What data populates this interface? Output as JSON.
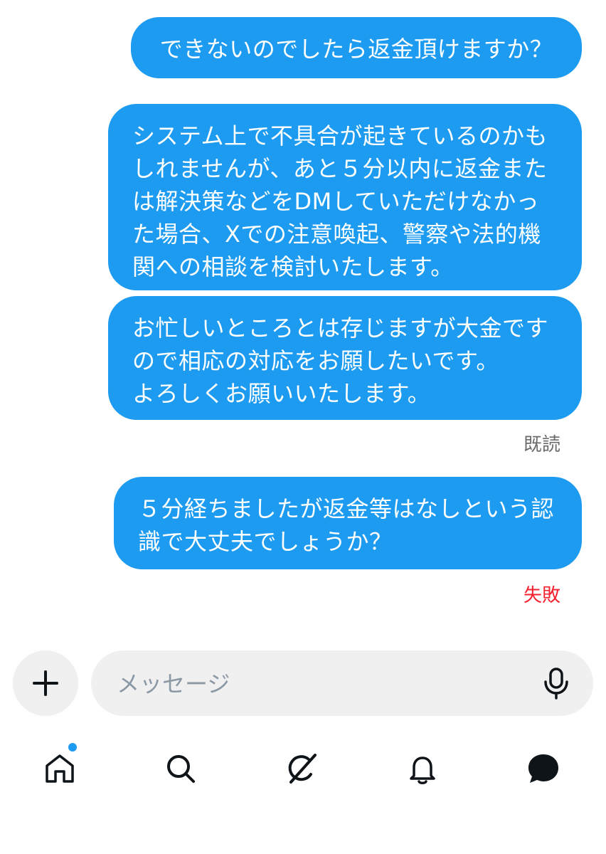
{
  "messages": [
    {
      "lines": [
        "できないのでしたら返金頂けますか？"
      ]
    },
    {
      "lines": [
        "システム上で不具合が起きているのかも",
        "しれませんが、あと５分以内に返金また",
        "は解決策などをDMしていただけなかっ",
        "た場合、Xでの注意喚起、警察や法的機",
        "関への相談を検討いたします。"
      ]
    },
    {
      "lines": [
        "お忙しいところとは存じますが大金です",
        "ので相応の対応をお願したいです。",
        "よろしくお願いいたします。"
      ]
    },
    {
      "lines": [
        "５分経ちましたが返金等はなしという認",
        "識で大丈夫でしょうか？"
      ]
    }
  ],
  "status": {
    "read": "既読",
    "failed": "失敗"
  },
  "composer": {
    "placeholder": "メッセージ"
  },
  "colors": {
    "accent": "#1d9bf0",
    "error": "#f4212e"
  },
  "icons": {
    "add": "plus-icon",
    "mic": "microphone-icon",
    "tabs": [
      "home-icon",
      "search-icon",
      "grok-icon",
      "notifications-icon",
      "messages-icon"
    ]
  }
}
